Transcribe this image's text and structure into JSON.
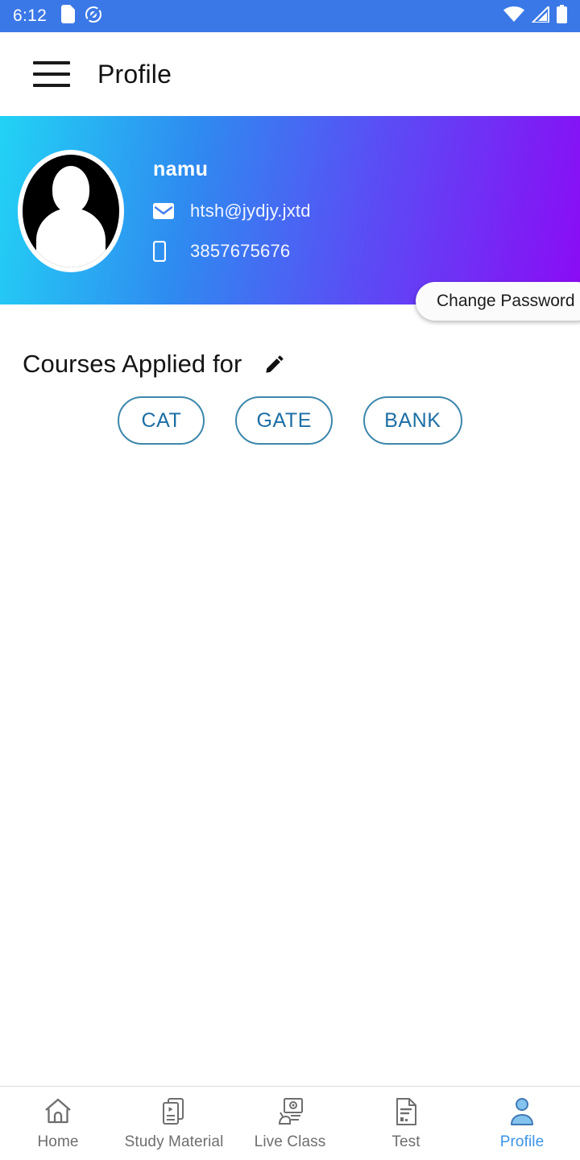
{
  "statusbar": {
    "clock": "6:12",
    "left_icons": [
      "sim-card-icon",
      "data-saver-icon"
    ],
    "right_icons": [
      "wifi-icon",
      "signal-icon",
      "battery-icon"
    ],
    "background": "#3b78e7"
  },
  "appbar": {
    "menu_icon": "hamburger-menu-icon",
    "title": "Profile"
  },
  "profile": {
    "avatar_icon": "default-user-avatar",
    "name": "namu",
    "email": "htsh@jydjy.jxtd",
    "email_icon": "envelope-icon",
    "phone": "3857675676",
    "phone_icon": "mobile-phone-icon",
    "gradient_from": "#22d3f5",
    "gradient_to": "#8b0bf5",
    "change_password_label": "Change Password"
  },
  "courses": {
    "heading": "Courses Applied for",
    "edit_icon": "pencil-edit-icon",
    "chips": [
      {
        "label": "CAT"
      },
      {
        "label": "GATE"
      },
      {
        "label": "BANK"
      }
    ],
    "chip_border_color": "#3d87ab",
    "chip_text_color": "#1c6ea4"
  },
  "bottomnav": {
    "active_color": "#3b95e8",
    "inactive_color": "#6e6e6e",
    "items": [
      {
        "label": "Home",
        "icon": "home-icon",
        "active": false
      },
      {
        "label": "Study Material",
        "icon": "documents-icon",
        "active": false
      },
      {
        "label": "Live Class",
        "icon": "live-class-icon",
        "active": false
      },
      {
        "label": "Test",
        "icon": "test-paper-icon",
        "active": false
      },
      {
        "label": "Profile",
        "icon": "person-icon",
        "active": true
      }
    ]
  }
}
